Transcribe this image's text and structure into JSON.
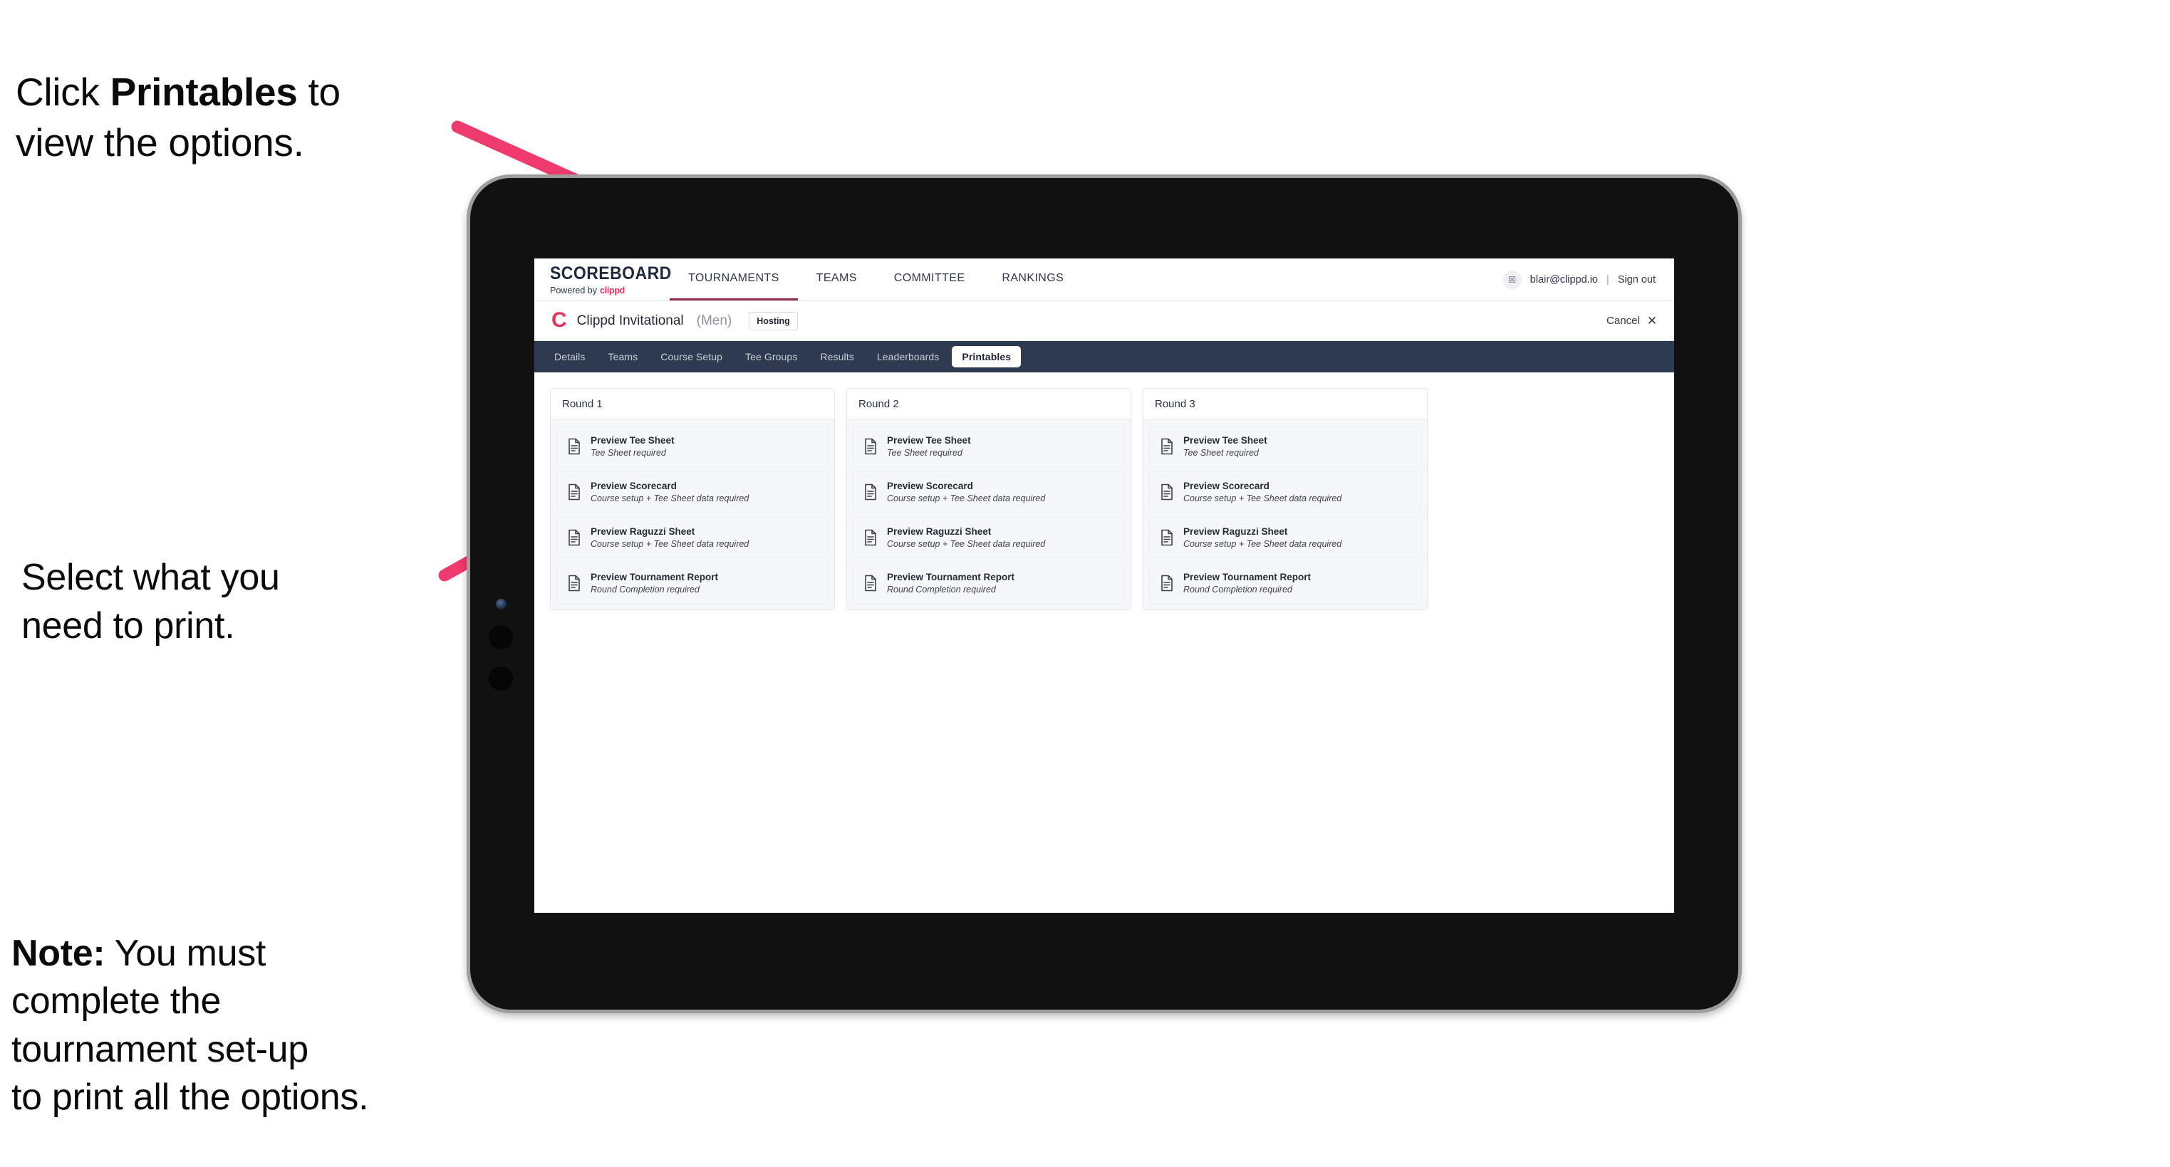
{
  "annotations": {
    "top": {
      "prefix": "Click ",
      "bold": "Printables",
      "suffix": " to\nview the options."
    },
    "middle": {
      "text": "Select what you\n need to print."
    },
    "note": {
      "bold": "Note:",
      "text": " You must\ncomplete the\ntournament set-up\nto print all the options."
    }
  },
  "colors": {
    "accent_pink": "#e8325b",
    "tabstrip_bg": "#2e3a4f",
    "nav_underline": "#8e2b45"
  },
  "app": {
    "brand": {
      "word": "SCOREBOARD",
      "powered_prefix": "Powered by",
      "powered_brand": "clippd"
    },
    "topnav": [
      {
        "label": "TOURNAMENTS",
        "active": true
      },
      {
        "label": "TEAMS",
        "active": false
      },
      {
        "label": "COMMITTEE",
        "active": false
      },
      {
        "label": "RANKINGS",
        "active": false
      }
    ],
    "user": {
      "avatar_glyph": "☒",
      "email": "blair@clippd.io",
      "separator": "|",
      "sign_out": "Sign out"
    },
    "tournament": {
      "logo_letter": "C",
      "name": "Clippd Invitational",
      "gender": "(Men)",
      "badge": "Hosting",
      "cancel_label": "Cancel",
      "cancel_icon": "✕"
    },
    "tabs": [
      {
        "label": "Details",
        "active": false
      },
      {
        "label": "Teams",
        "active": false
      },
      {
        "label": "Course Setup",
        "active": false
      },
      {
        "label": "Tee Groups",
        "active": false
      },
      {
        "label": "Results",
        "active": false
      },
      {
        "label": "Leaderboards",
        "active": false
      },
      {
        "label": "Printables",
        "active": true
      }
    ],
    "rounds": [
      {
        "title": "Round 1",
        "items": [
          {
            "icon": "document-icon",
            "title": "Preview Tee Sheet",
            "subtitle": "Tee Sheet required"
          },
          {
            "icon": "document-icon",
            "title": "Preview Scorecard",
            "subtitle": "Course setup + Tee Sheet data required"
          },
          {
            "icon": "document-icon",
            "title": "Preview Raguzzi Sheet",
            "subtitle": "Course setup + Tee Sheet data required"
          },
          {
            "icon": "document-icon",
            "title": "Preview Tournament Report",
            "subtitle": "Round Completion required"
          }
        ]
      },
      {
        "title": "Round 2",
        "items": [
          {
            "icon": "document-icon",
            "title": "Preview Tee Sheet",
            "subtitle": "Tee Sheet required"
          },
          {
            "icon": "document-icon",
            "title": "Preview Scorecard",
            "subtitle": "Course setup + Tee Sheet data required"
          },
          {
            "icon": "document-icon",
            "title": "Preview Raguzzi Sheet",
            "subtitle": "Course setup + Tee Sheet data required"
          },
          {
            "icon": "document-icon",
            "title": "Preview Tournament Report",
            "subtitle": "Round Completion required"
          }
        ]
      },
      {
        "title": "Round 3",
        "items": [
          {
            "icon": "document-icon",
            "title": "Preview Tee Sheet",
            "subtitle": "Tee Sheet required"
          },
          {
            "icon": "document-icon",
            "title": "Preview Scorecard",
            "subtitle": "Course setup + Tee Sheet data required"
          },
          {
            "icon": "document-icon",
            "title": "Preview Raguzzi Sheet",
            "subtitle": "Course setup + Tee Sheet data required"
          },
          {
            "icon": "document-icon",
            "title": "Preview Tournament Report",
            "subtitle": "Round Completion required"
          }
        ]
      }
    ]
  }
}
